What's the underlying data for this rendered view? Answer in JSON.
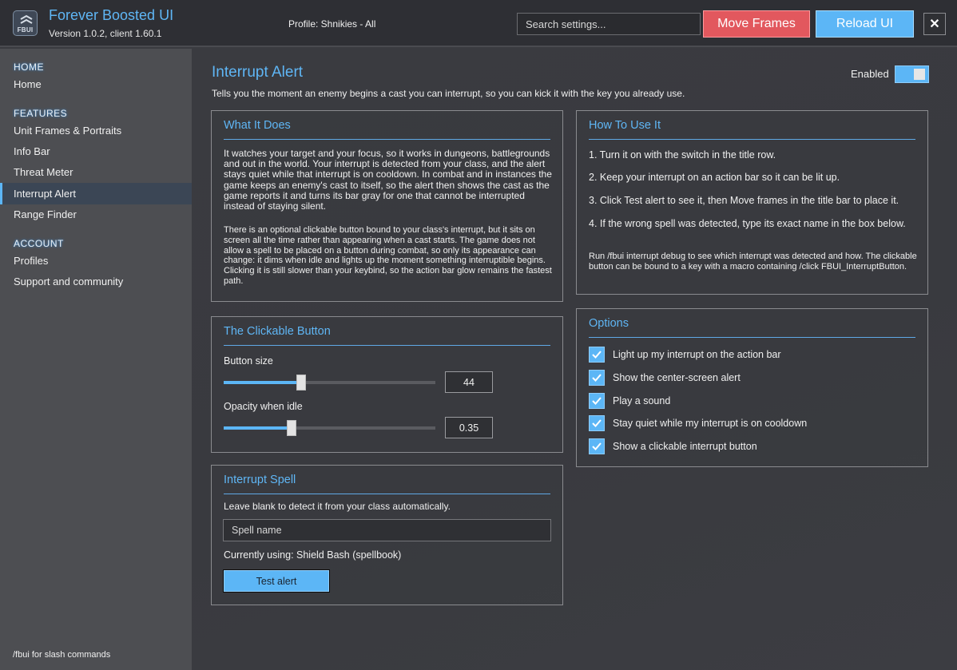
{
  "app": {
    "logo_text": "FBUI",
    "title": "Forever Boosted UI",
    "version": "Version 1.0.2, client 1.60.1",
    "profile": "Profile: Shnikies - All"
  },
  "toolbar": {
    "search_placeholder": "Search settings...",
    "move_frames_label": "Move Frames",
    "reload_label": "Reload UI",
    "close_label": "✕"
  },
  "sidebar": {
    "home_header": "HOME",
    "home_items": [
      "Home"
    ],
    "features_header": "FEATURES",
    "features_items": [
      "Unit Frames & Portraits",
      "Info Bar",
      "Threat Meter",
      "Interrupt Alert",
      "Range Finder"
    ],
    "active_item": "Interrupt Alert",
    "account_header": "ACCOUNT",
    "account_items": [
      "Profiles",
      "Support and community"
    ],
    "footer": "/fbui for slash commands"
  },
  "page": {
    "title": "Interrupt Alert",
    "description": "Tells you the moment an enemy begins a cast you can interrupt, so you can kick it with the key you already use.",
    "enabled_label": "Enabled",
    "enabled": true
  },
  "what_it_does": {
    "title": "What It Does",
    "para1": "It watches your target and your focus, so it works in dungeons, battlegrounds and out in the world.  Your interrupt is detected from your class, and the alert stays quiet while that interrupt is on cooldown.  In combat and in instances the game keeps an enemy's cast to itself, so the alert then shows the cast as the game reports it and turns its bar gray for one that cannot be interrupted instead of staying silent.",
    "para2": "There is an optional clickable button bound to your class's interrupt, but it sits on screen all the time rather than appearing when a cast starts.  The game does not allow a spell to be placed on a button during combat, so only its appearance can change: it dims when idle and lights up the moment something interruptible begins.  Clicking it is still slower than your keybind, so the action bar glow remains the fastest path."
  },
  "how_to_use": {
    "title": "How To Use It",
    "steps": [
      "1.  Turn it on with the switch in the title row.",
      "2.  Keep your interrupt on an action bar so it can be lit up.",
      "3.  Click Test alert to see it, then Move frames in the title bar to place it.",
      "4.  If the wrong spell was detected, type its exact name in the box below."
    ],
    "note": "Run /fbui interrupt debug to see which interrupt was detected and how.  The clickable button can be bound to a key with a macro containing /click FBUI_InterruptButton."
  },
  "clickable_button": {
    "title": "The Clickable Button",
    "size_label": "Button size",
    "size_value": "44",
    "size_fraction": 0.367,
    "opacity_label": "Opacity when idle",
    "opacity_value": "0.35",
    "opacity_fraction": 0.32
  },
  "interrupt_spell": {
    "title": "Interrupt Spell",
    "hint": "Leave blank to detect it from your class automatically.",
    "input_placeholder": "Spell name",
    "current": "Currently using: Shield Bash  (spellbook)",
    "test_label": "Test alert"
  },
  "options": {
    "title": "Options",
    "items": [
      {
        "label": "Light up my interrupt on the action bar",
        "checked": true
      },
      {
        "label": "Show the center-screen alert",
        "checked": true
      },
      {
        "label": "Play a sound",
        "checked": true
      },
      {
        "label": "Stay quiet while my interrupt is on cooldown",
        "checked": true
      },
      {
        "label": "Show a clickable interrupt button",
        "checked": true
      }
    ]
  },
  "colors": {
    "accent": "#5cb6f6",
    "danger": "#e2585e",
    "sidebar_bg": "#4d4e52",
    "main_bg": "#3a3b40"
  }
}
